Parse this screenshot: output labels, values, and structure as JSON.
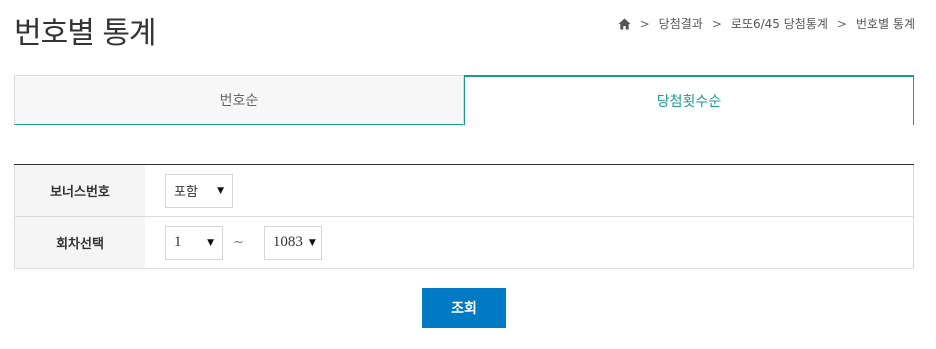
{
  "page": {
    "title": "번호별 통계"
  },
  "breadcrumb": {
    "home_icon": "home-icon",
    "items": [
      "당첨결과",
      "로또6/45 당첨통계",
      "번호별 통계"
    ]
  },
  "tabs": [
    {
      "label": "번호순",
      "active": false
    },
    {
      "label": "당첨횟수순",
      "active": true
    }
  ],
  "filters": {
    "bonus": {
      "label": "보너스번호",
      "selected": "포함"
    },
    "round": {
      "label": "회차선택",
      "from": "1",
      "separator": "~",
      "to": "1083"
    }
  },
  "actions": {
    "search_label": "조회"
  },
  "colors": {
    "accent": "#1a9b8d",
    "button": "#007bc3"
  }
}
